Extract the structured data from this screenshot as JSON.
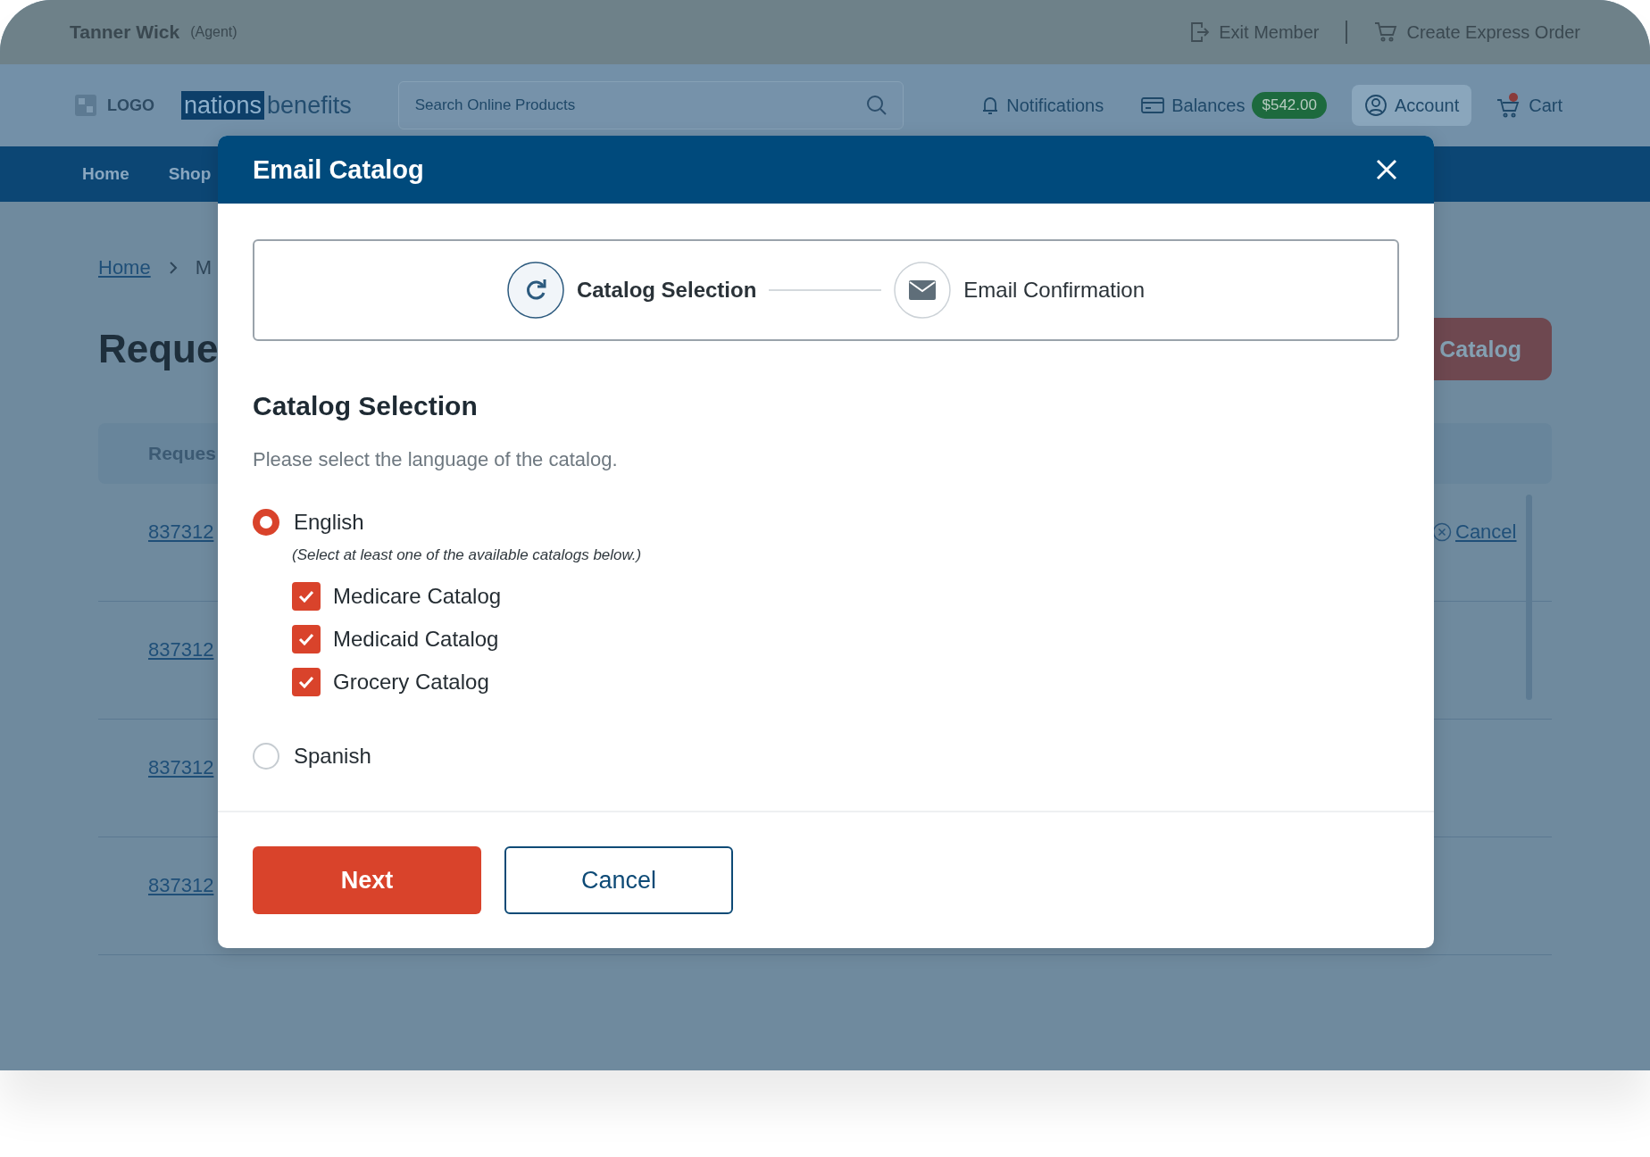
{
  "top_bar": {
    "user_name": "Tanner Wick",
    "role": "(Agent)",
    "actions": [
      {
        "label": "Exit Member",
        "kind": "exit"
      },
      {
        "label": "Create Express Order",
        "kind": "cart"
      }
    ]
  },
  "header": {
    "logo": "LOGO",
    "brand": {
      "part_1": "nations",
      "part_2": "benefits"
    },
    "search": {
      "placeholder": "Search Online Products"
    },
    "items": [
      {
        "label": "Notifications",
        "kind": "bell",
        "selected": false
      },
      {
        "label": "Balances",
        "kind": "wallet",
        "badge": "$542.00",
        "selected": false
      },
      {
        "label": "Account",
        "kind": "account",
        "selected": true
      },
      {
        "label": "Cart",
        "kind": "cart",
        "selected": false
      }
    ]
  },
  "nav": [
    "Home",
    "Shop"
  ],
  "background_page": {
    "breadcrumb": [
      "Home",
      "M"
    ],
    "title": "Reque",
    "primary_button": "Catalog",
    "table": {
      "header": "Reques",
      "rows": [
        {
          "id": "837312",
          "action": "Cancel"
        },
        {
          "id": "837312"
        },
        {
          "id": "837312"
        },
        {
          "id": "837312"
        }
      ]
    }
  },
  "modal": {
    "title": "Email Catalog",
    "steps": [
      {
        "label": "Catalog Selection",
        "kind": "refresh",
        "selected": true
      },
      {
        "label": "Email Confirmation",
        "kind": "mail",
        "selected": false
      }
    ],
    "section_title": "Catalog Selection",
    "instruction": "Please select the language of the catalog.",
    "languages": [
      {
        "label": "English",
        "selected": true,
        "hint": "(Select at least one of the available catalogs below.)",
        "catalogs": [
          {
            "label": "Medicare Catalog",
            "checked": true
          },
          {
            "label": "Medicaid Catalog",
            "checked": true
          },
          {
            "label": "Grocery Catalog",
            "checked": true
          }
        ]
      },
      {
        "label": "Spanish",
        "selected": false
      }
    ],
    "buttons": [
      {
        "label": "Next",
        "kind": "primary"
      },
      {
        "label": "Cancel",
        "kind": "secondary"
      }
    ]
  }
}
